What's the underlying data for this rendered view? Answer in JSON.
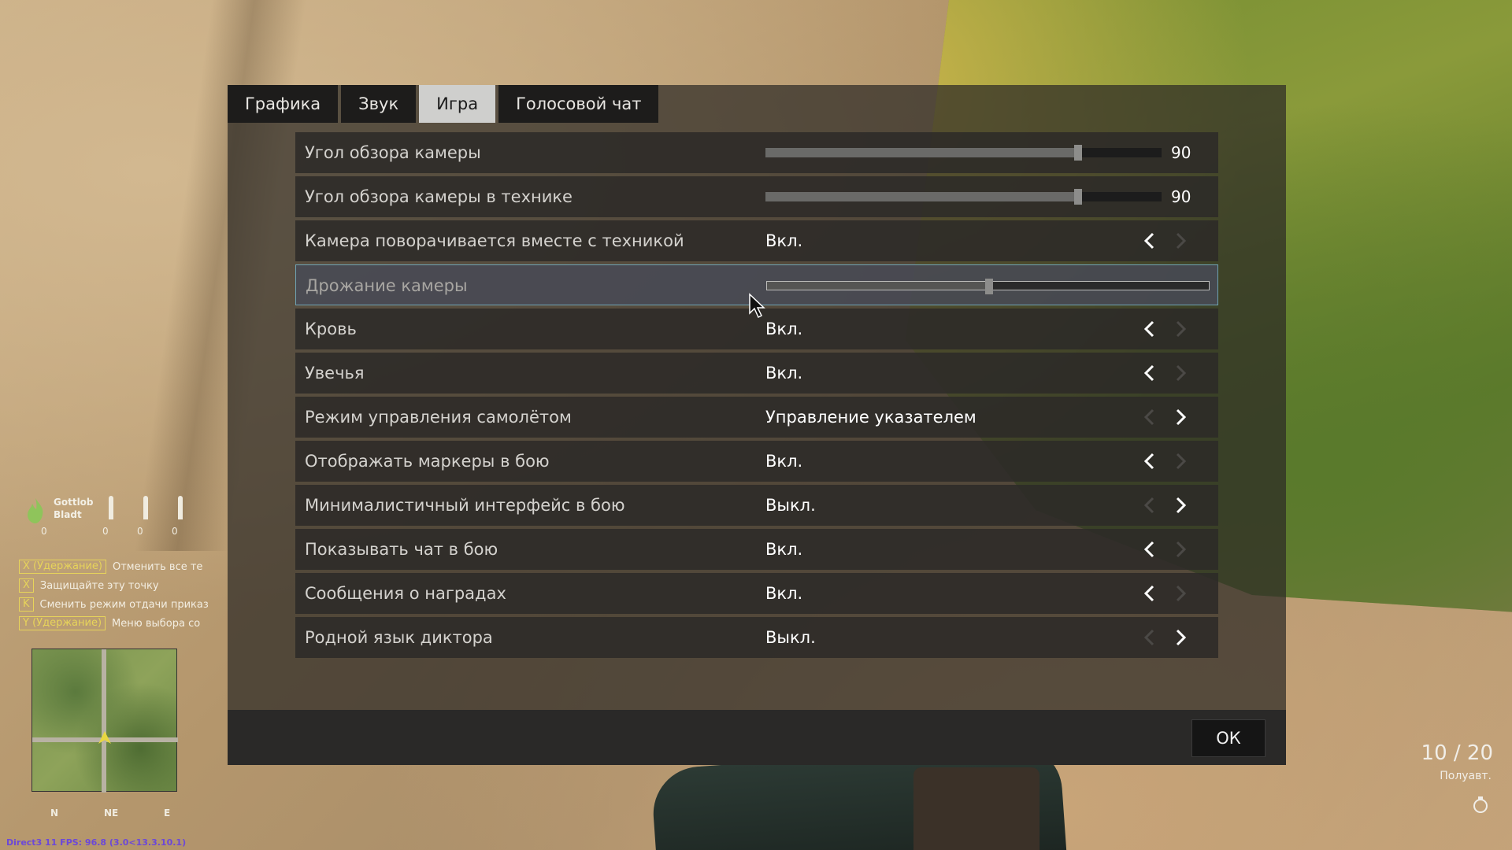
{
  "tabs": [
    {
      "label": "Графика",
      "active": false
    },
    {
      "label": "Звук",
      "active": false
    },
    {
      "label": "Игра",
      "active": true
    },
    {
      "label": "Голосовой чат",
      "active": false
    }
  ],
  "settings": [
    {
      "label": "Угол обзора камеры",
      "type": "slider",
      "value": "90",
      "fraction": 0.79
    },
    {
      "label": "Угол обзора камеры в технике",
      "type": "slider",
      "value": "90",
      "fraction": 0.79
    },
    {
      "label": "Камера поворачивается вместе с техникой",
      "type": "choice",
      "value": "Вкл.",
      "left_enabled": true,
      "right_enabled": false
    },
    {
      "label": "Дрожание камеры",
      "type": "slider",
      "value": "",
      "fraction": 0.5,
      "highlighted": true
    },
    {
      "label": "Кровь",
      "type": "choice",
      "value": "Вкл.",
      "left_enabled": true,
      "right_enabled": false
    },
    {
      "label": "Увечья",
      "type": "choice",
      "value": "Вкл.",
      "left_enabled": true,
      "right_enabled": false
    },
    {
      "label": "Режим управления самолётом",
      "type": "choice",
      "value": "Управление указателем",
      "left_enabled": false,
      "right_enabled": true
    },
    {
      "label": "Отображать маркеры в бою",
      "type": "choice",
      "value": "Вкл.",
      "left_enabled": true,
      "right_enabled": false
    },
    {
      "label": "Минималистичный интерфейс в бою",
      "type": "choice",
      "value": "Выкл.",
      "left_enabled": false,
      "right_enabled": true
    },
    {
      "label": "Показывать чат в бою",
      "type": "choice",
      "value": "Вкл.",
      "left_enabled": true,
      "right_enabled": false
    },
    {
      "label": "Сообщения о наградах",
      "type": "choice",
      "value": "Вкл.",
      "left_enabled": true,
      "right_enabled": false
    },
    {
      "label": "Родной язык диктора",
      "type": "choice",
      "value": "Выкл.",
      "left_enabled": false,
      "right_enabled": true
    }
  ],
  "footer": {
    "ok_label": "ОК"
  },
  "hud": {
    "squad_leader": "Gottlob\nBladt",
    "soldier_counts": [
      "0",
      "0",
      "0",
      "0"
    ],
    "commands": [
      {
        "key": "X",
        "hold": "(Удержание)",
        "text": "Отменить все те"
      },
      {
        "key": "X",
        "hold": "",
        "text": "Защищайте эту точку"
      },
      {
        "key": "K",
        "hold": "",
        "text": "Сменить режим отдачи приказ"
      },
      {
        "key": "Y",
        "hold": "(Удержание)",
        "text": "Меню выбора со"
      }
    ],
    "compass": [
      "N",
      "NE",
      "E"
    ],
    "ammo": "10 / 20",
    "fire_mode": "Полуавт.",
    "fps_text": "Direct3 11 FPS: 96.8 (3.0<13.3.10.1)"
  },
  "colors": {
    "active_tab_bg": "#cfcfcd",
    "tab_bg": "#1d1c1b",
    "highlight_border": "#6fa3b3",
    "key_yellow": "#e7d45a"
  }
}
